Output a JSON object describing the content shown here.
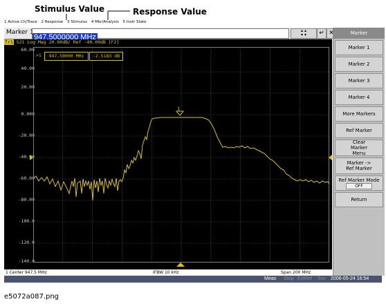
{
  "callouts": {
    "stimulus": "Stimulus Value",
    "response": "Response Value"
  },
  "menu": [
    "1 Active Ch/Trace",
    "2 Response",
    "3 Stimulus",
    "4 Mkr/Analysis",
    "5 Instr State"
  ],
  "entry": {
    "label": "Marker 1",
    "value": "947.5000000 MHz"
  },
  "trace": {
    "label": "Tr1",
    "header": "S21 Log Mag 20.00dB/ Ref -40.00dB [F2]"
  },
  "y_axis": [
    "60.00",
    "40.00",
    "20.00",
    "0.000",
    "-20.00",
    "-40.00",
    "-60.00",
    "-80.00",
    "-100.0",
    "-120.0",
    "-140.0"
  ],
  "marker_readout": {
    "prefix": ">1",
    "stimulus": "947.50000 MHz",
    "response": "-2.5183 dB",
    "marker_symbol": "1"
  },
  "bottom": {
    "left": "1 Center 947.5 MHz",
    "center": "IFBW 10 kHz",
    "right": "Span 200 MHz"
  },
  "status": {
    "meas": "Meas",
    "stop": "Stop",
    "extref": "ExtRef",
    "svc": "Svc",
    "datetime": "2006-05-24 16:54"
  },
  "softkeys": {
    "title": "Marker",
    "keys": [
      {
        "label": "Marker 1"
      },
      {
        "label": "Marker 2"
      },
      {
        "label": "Marker 3"
      },
      {
        "label": "Marker 4"
      },
      {
        "label": "More Markers"
      },
      {
        "label": "Ref Marker"
      },
      {
        "label": "Clear Marker Menu"
      },
      {
        "label": "Marker -> Ref Marker"
      },
      {
        "label": "Ref Marker Mode",
        "value": "OFF"
      },
      {
        "label": "Return"
      }
    ]
  },
  "colors": {
    "trace": "#d8c02a",
    "background": "#000000",
    "highlight": "#1b3cc8"
  },
  "caption": "e5072a087.png"
}
